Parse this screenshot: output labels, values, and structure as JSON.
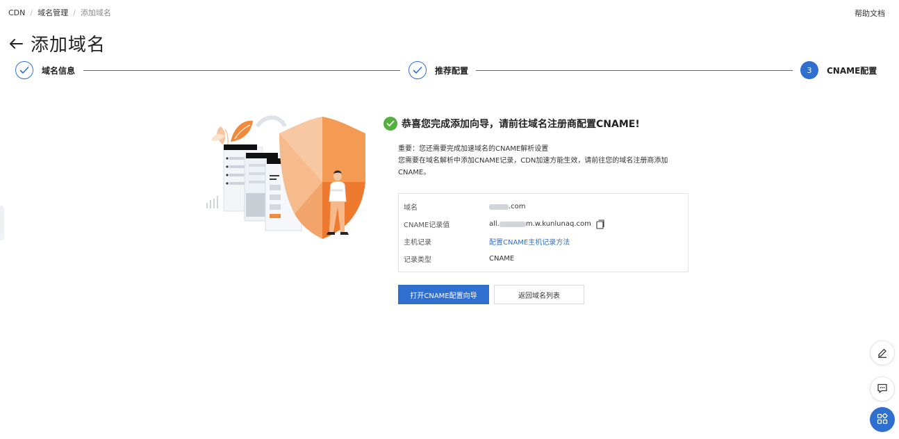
{
  "breadcrumb": {
    "items": [
      "CDN",
      "域名管理",
      "添加域名"
    ],
    "separator": "/"
  },
  "help_label": "帮助文档",
  "page_title": "添加域名",
  "steps": [
    {
      "label": "域名信息",
      "status": "done"
    },
    {
      "label": "推荐配置",
      "status": "done"
    },
    {
      "number": "3",
      "label": "CNAME配置",
      "status": "active"
    }
  ],
  "result": {
    "title": "恭喜您完成添加向导，请前往域名注册商配置CNAME!",
    "notes": [
      "重要：您还需要完成加速域名的CNAME解析设置",
      "您需要在域名解析中添加CNAME记录，CDN加速方能生效，请前往您的域名注册商添加CNAME。"
    ]
  },
  "info": {
    "domain_label": "域名",
    "domain_value": ".com",
    "cname_label": "CNAME记录值",
    "cname_value_prefix": "all.",
    "cname_value_suffix": "m.w.kunlunaq.com",
    "host_label": "主机记录",
    "host_link": "配置CNAME主机记录方法",
    "type_label": "记录类型",
    "type_value": "CNAME"
  },
  "buttons": {
    "open_wizard": "打开CNAME配置向导",
    "back_list": "返回域名列表"
  },
  "colors": {
    "primary": "#2e6fd0",
    "success": "#52b13d",
    "shield_orange": "#f08a3c"
  },
  "icons": {
    "back": "arrow-left-icon",
    "check": "check-icon",
    "success": "check-circle-icon",
    "copy": "copy-icon",
    "edit": "pencil-icon",
    "feedback": "chat-icon",
    "apps": "grid-icon"
  }
}
